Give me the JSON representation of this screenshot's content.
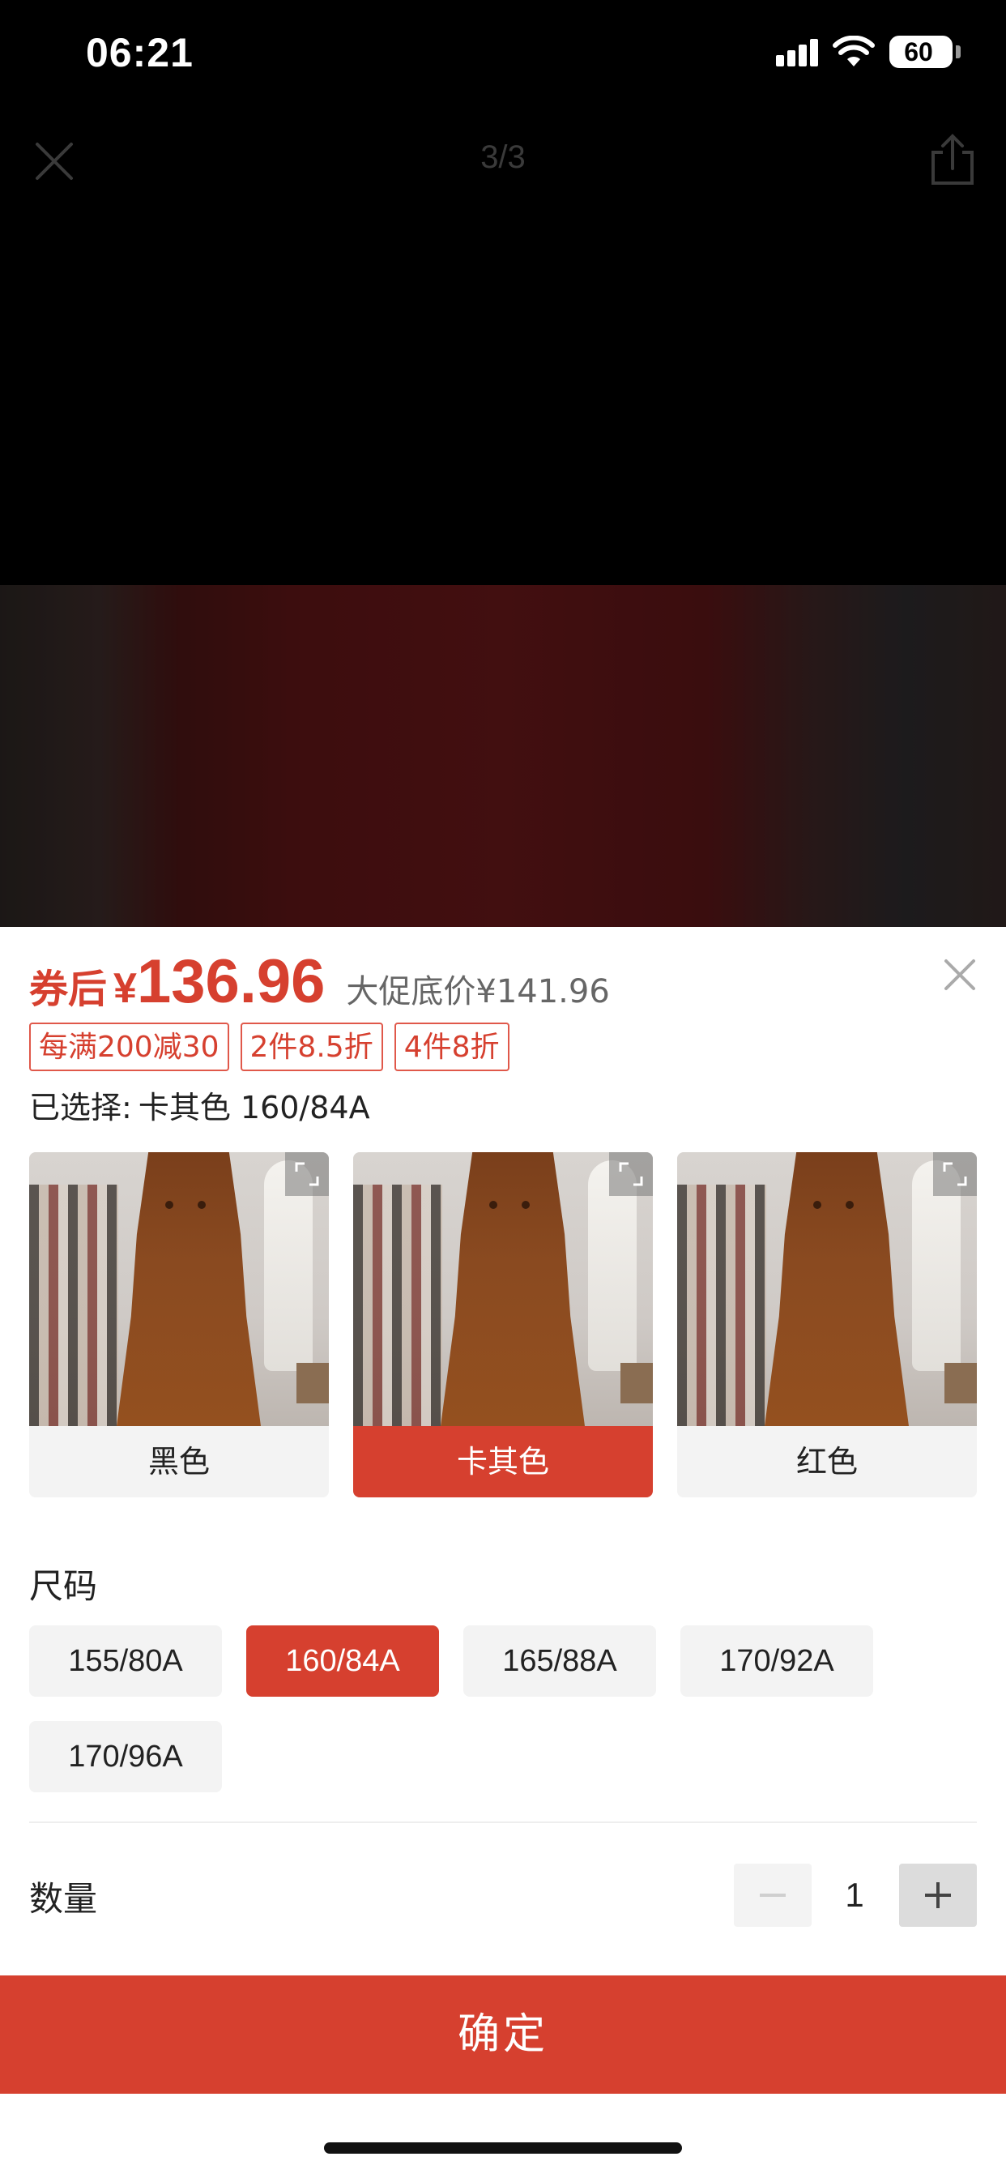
{
  "status": {
    "time": "06:21",
    "battery": "60"
  },
  "viewer": {
    "counter": "3/3"
  },
  "sheet": {
    "price_label": "券后",
    "price_symbol": "¥",
    "price_value": "136.96",
    "promo_price": "大促底价¥141.96",
    "tags": [
      "每满200减30",
      "2件8.5折",
      "4件8折"
    ],
    "selected_prefix": "已选择:",
    "selected_value": "卡其色 160/84A",
    "colors": [
      {
        "label": "黑色",
        "active": false
      },
      {
        "label": "卡其色",
        "active": true
      },
      {
        "label": "红色",
        "active": false
      }
    ],
    "size_title": "尺码",
    "sizes": [
      {
        "label": "155/80A",
        "active": false
      },
      {
        "label": "160/84A",
        "active": true
      },
      {
        "label": "165/88A",
        "active": false
      },
      {
        "label": "170/92A",
        "active": false
      },
      {
        "label": "170/96A",
        "active": false
      }
    ],
    "qty_title": "数量",
    "qty_value": "1",
    "confirm_label": "确定"
  },
  "colors": {
    "accent": "#d6402f",
    "chip_bg": "#f3f3f3"
  },
  "icons": [
    "close-icon",
    "share-icon",
    "expand-icon",
    "minus-icon",
    "plus-icon",
    "signal-icon",
    "wifi-icon",
    "battery-icon"
  ]
}
